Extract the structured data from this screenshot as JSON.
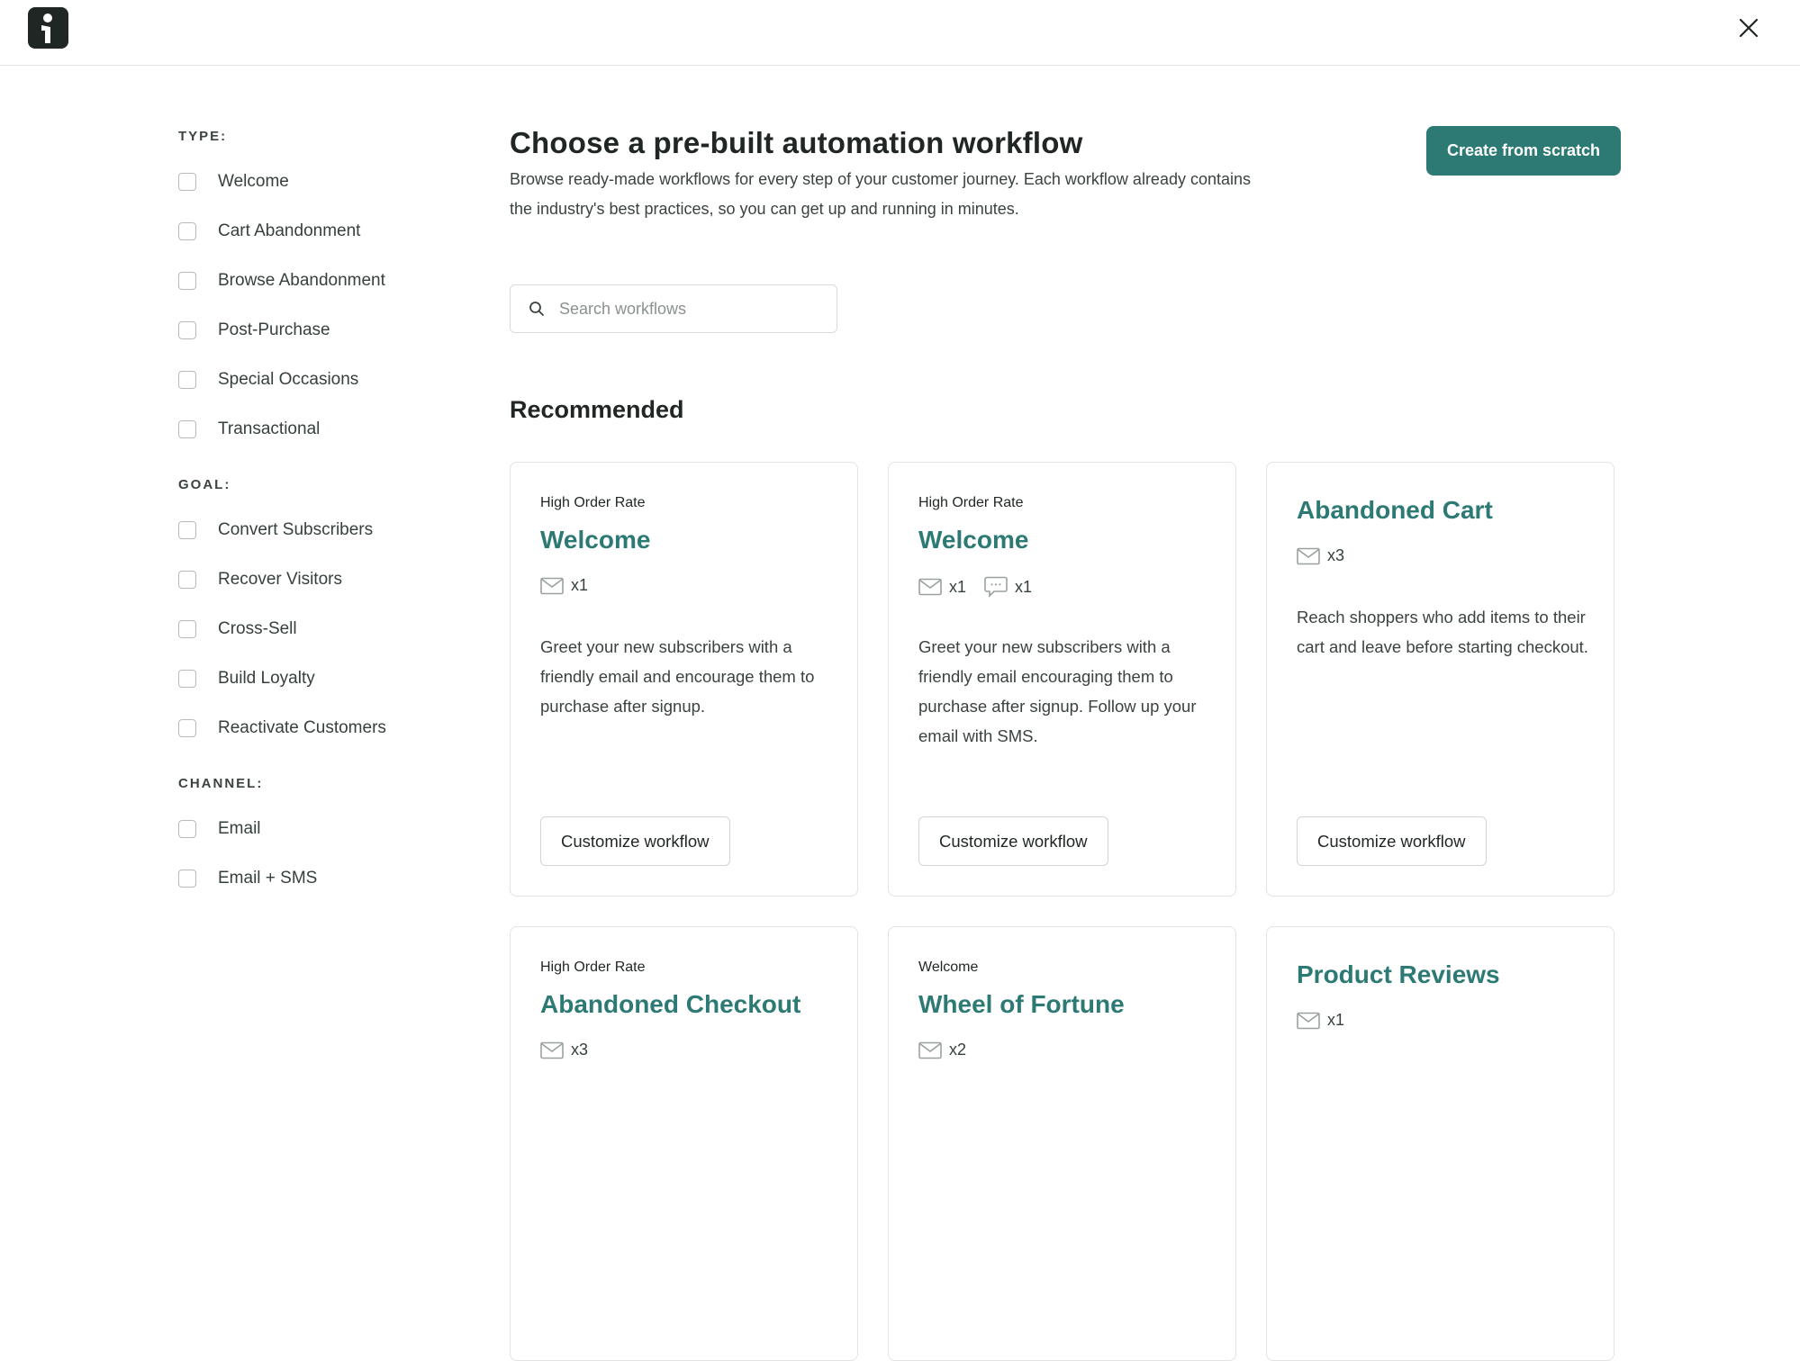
{
  "header": {
    "logo_icon": "brand-logo-icon",
    "close_icon": "close-icon"
  },
  "sidebar": {
    "groups": [
      {
        "title": "TYPE:",
        "items": [
          "Welcome",
          "Cart Abandonment",
          "Browse Abandonment",
          "Post-Purchase",
          "Special Occasions",
          "Transactional"
        ]
      },
      {
        "title": "GOAL:",
        "items": [
          "Convert Subscribers",
          "Recover Visitors",
          "Cross-Sell",
          "Build Loyalty",
          "Reactivate Customers"
        ]
      },
      {
        "title": "CHANNEL:",
        "items": [
          "Email",
          "Email + SMS"
        ]
      }
    ]
  },
  "main": {
    "title": "Choose a pre-built automation workflow",
    "description": "Browse ready-made workflows for every step of your customer journey. Each workflow already contains the industry's best practices, so you can get up and running in minutes.",
    "create_button": "Create from scratch",
    "search": {
      "placeholder": "Search workflows",
      "value": ""
    },
    "section_title": "Recommended",
    "cards": [
      {
        "tag": "High Order Rate",
        "title": "Welcome",
        "channels": [
          {
            "icon": "email-icon",
            "count": "x1"
          }
        ],
        "description": "Greet your new subscribers with a friendly email and encourage them to purchase after signup.",
        "button": "Customize workflow"
      },
      {
        "tag": "High Order Rate",
        "title": "Welcome",
        "channels": [
          {
            "icon": "email-icon",
            "count": "x1"
          },
          {
            "icon": "sms-icon",
            "count": "x1"
          }
        ],
        "description": "Greet your new subscribers with a friendly email encouraging them to purchase after signup. Follow up your email with SMS.",
        "button": "Customize workflow"
      },
      {
        "tag": "",
        "title": "Abandoned Cart",
        "channels": [
          {
            "icon": "email-icon",
            "count": "x3"
          }
        ],
        "description": "Reach shoppers who add items to their cart and leave before starting checkout.",
        "button": "Customize workflow"
      },
      {
        "tag": "High Order Rate",
        "title": "Abandoned Checkout",
        "channels": [
          {
            "icon": "email-icon",
            "count": "x3"
          }
        ],
        "description": "",
        "button": ""
      },
      {
        "tag": "Welcome",
        "title": "Wheel of Fortune",
        "channels": [
          {
            "icon": "email-icon",
            "count": "x2"
          }
        ],
        "description": "",
        "button": ""
      },
      {
        "tag": "",
        "title": "Product Reviews",
        "channels": [
          {
            "icon": "email-icon",
            "count": "x1"
          }
        ],
        "description": "",
        "button": ""
      }
    ]
  },
  "colors": {
    "accent": "#2d7a75",
    "text": "#1f2623",
    "border": "#e1e4e3"
  }
}
